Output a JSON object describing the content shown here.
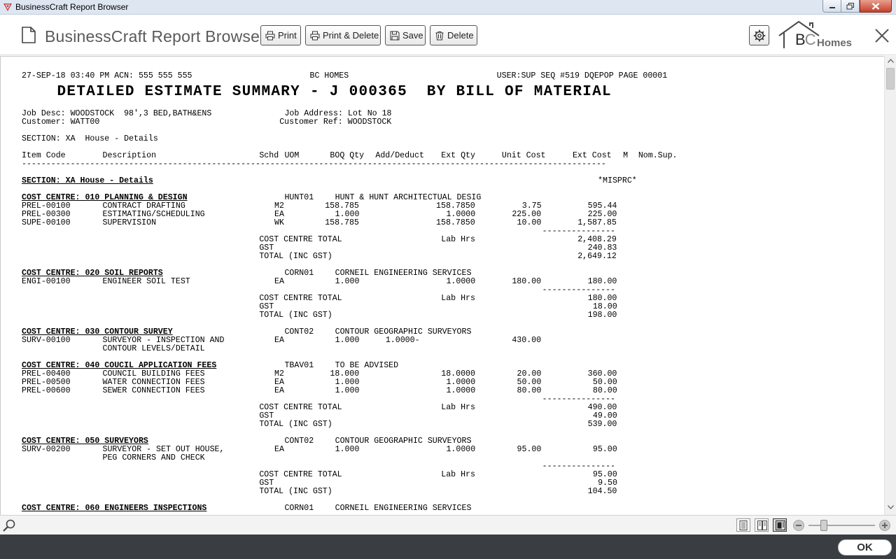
{
  "window": {
    "title": "BusinessCraft Report Browser",
    "colors": {
      "titlebar": "#dde6f1",
      "close": "#c4412b",
      "bottombar": "#3a3d42"
    }
  },
  "toolbar": {
    "app_title": "BusinessCraft Report Browser",
    "print_label": "Print",
    "print_delete_label": "Print & Delete",
    "save_label": "Save",
    "delete_label": "Delete",
    "logo_bc": "BC",
    "logo_homes": "Homes"
  },
  "report": {
    "header_left": "27-SEP-18 03:40 PM ACN: 555 555 555",
    "header_center": "BC HOMES",
    "header_right": "USER:SUP SEQ #519 DQEPOP PAGE 00001",
    "title": "DETAILED ESTIMATE SUMMARY - J 000365  BY BILL OF MATERIAL",
    "job_desc": "Job Desc: WOODSTOCK  98',3 BED,BATH&ENS",
    "job_address": "Job Address: Lot No 18",
    "customer": "Customer: WATT00",
    "customer_ref": "Customer Ref: WOODSTOCK",
    "section_line": "SECTION: XA  House - Details",
    "columns": {
      "item_code": "Item Code",
      "description": "Description",
      "schd": "Schd",
      "uom": "UOM",
      "boq_qty": "BOQ Qty",
      "add_deduct": "Add/Deduct",
      "ext_qty": "Ext Qty",
      "unit_cost": "Unit Cost",
      "ext_cost": "Ext Cost",
      "m": "M",
      "nom_sup": "Nom.Sup."
    },
    "dashes": "------------------------------------------------------------------------------------------------------------------------",
    "short_dashes": "---------------",
    "section_heading": "SECTION: XA House - Details",
    "misprc": "*MISPRC*",
    "labels": {
      "cc_total": "COST CENTRE TOTAL",
      "lab_hrs": "Lab Hrs",
      "gst": "GST",
      "total_inc": "TOTAL (INC GST)"
    },
    "cost_centres": [
      {
        "heading": "COST CENTRE: 010 PLANNING & DESIGN",
        "supplier_code": "HUNT01",
        "supplier_name": "HUNT & HUNT ARCHITECTUAL DESIG",
        "items": [
          {
            "code": "PREL-00100",
            "desc": "CONTRACT DRAFTING",
            "uom": "M2",
            "boq": "158.785",
            "add": "",
            "ext_qty": "158.7850",
            "unit": "3.75",
            "ext_cost": "595.44"
          },
          {
            "code": "PREL-00300",
            "desc": "ESTIMATING/SCHEDULING",
            "uom": "EA",
            "boq": "1.000",
            "add": "",
            "ext_qty": "1.0000",
            "unit": "225.00",
            "ext_cost": "225.00"
          },
          {
            "code": "SUPE-00100",
            "desc": "SUPERVISION",
            "uom": "WK",
            "boq": "158.785",
            "add": "",
            "ext_qty": "158.7850",
            "unit": "10.00",
            "ext_cost": "1,587.85"
          }
        ],
        "total": "2,408.29",
        "gst": "240.83",
        "total_inc": "2,649.12"
      },
      {
        "heading": "COST CENTRE: 020 SOIL REPORTS",
        "supplier_code": "CORN01",
        "supplier_name": "CORNEIL ENGINEERING SERVICES",
        "items": [
          {
            "code": "ENGI-00100",
            "desc": "ENGINEER SOIL TEST",
            "uom": "EA",
            "boq": "1.000",
            "add": "",
            "ext_qty": "1.0000",
            "unit": "180.00",
            "ext_cost": "180.00"
          }
        ],
        "total": "180.00",
        "gst": "18.00",
        "total_inc": "198.00"
      },
      {
        "heading": "COST CENTRE: 030 CONTOUR SURVEY",
        "supplier_code": "CONT02",
        "supplier_name": "CONTOUR GEOGRAPHIC SURVEYORS",
        "items": [
          {
            "code": "SURV-00100",
            "desc": "SURVEYOR - INSPECTION AND",
            "desc2": "CONTOUR LEVELS/DETAIL",
            "uom": "EA",
            "boq": "1.000",
            "add": "1.0000-",
            "ext_qty": "",
            "unit": "430.00",
            "ext_cost": ""
          }
        ]
      },
      {
        "heading": "COST CENTRE: 040 COUCIL APPLICATION FEES",
        "supplier_code": "TBAV01",
        "supplier_name": "TO BE ADVISED",
        "items": [
          {
            "code": "PREL-00400",
            "desc": "COUNCIL BUILDING FEES",
            "uom": "M2",
            "boq": "18.000",
            "add": "",
            "ext_qty": "18.0000",
            "unit": "20.00",
            "ext_cost": "360.00"
          },
          {
            "code": "PREL-00500",
            "desc": "WATER CONNECTION FEES",
            "uom": "EA",
            "boq": "1.000",
            "add": "",
            "ext_qty": "1.0000",
            "unit": "50.00",
            "ext_cost": "50.00"
          },
          {
            "code": "PREL-00600",
            "desc": "SEWER CONNECTION FEES",
            "uom": "EA",
            "boq": "1.000",
            "add": "",
            "ext_qty": "1.0000",
            "unit": "80.00",
            "ext_cost": "80.00"
          }
        ],
        "total": "490.00",
        "gst": "49.00",
        "total_inc": "539.00"
      },
      {
        "heading": "COST CENTRE: 050 SURVEYORS",
        "supplier_code": "CONT02",
        "supplier_name": "CONTOUR GEOGRAPHIC SURVEYORS",
        "items": [
          {
            "code": "SURV-00200",
            "desc": "SURVEYOR - SET OUT HOUSE,",
            "desc2": "PEG CORNERS AND CHECK",
            "uom": "EA",
            "boq": "1.000",
            "add": "",
            "ext_qty": "1.0000",
            "unit": "95.00",
            "ext_cost": "95.00"
          }
        ],
        "total": "95.00",
        "gst": "9.50",
        "total_inc": "104.50"
      },
      {
        "heading": "COST CENTRE: 060 ENGINEERS INSPECTIONS",
        "supplier_code": "CORN01",
        "supplier_name": "CORNEIL ENGINEERING SERVICES",
        "items": []
      }
    ]
  },
  "footer": {
    "ok_label": "OK",
    "zoom_level": 0.2
  }
}
